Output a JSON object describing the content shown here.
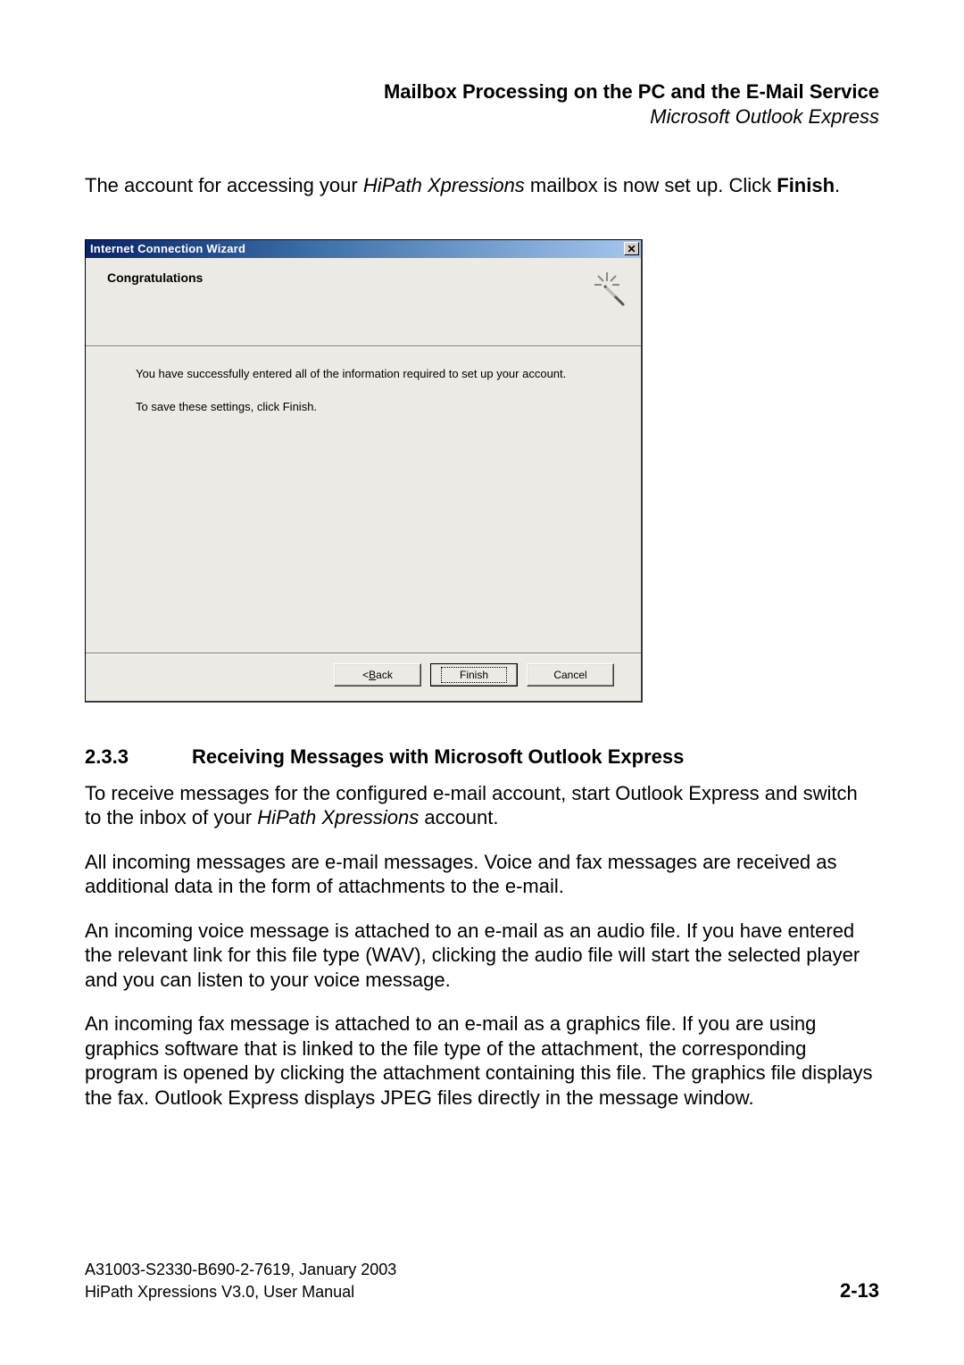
{
  "header": {
    "title": "Mailbox Processing on the PC and the E-Mail Service",
    "subtitle": "Microsoft Outlook Express"
  },
  "lead": {
    "pre": "The account for accessing your ",
    "italic": "HiPath Xpressions",
    "mid": " mailbox is now set up. Click ",
    "bold": "Finish",
    "post": "."
  },
  "dialog": {
    "title": "Internet Connection Wizard",
    "heading": "Congratulations",
    "body_line1": "You have successfully entered all of the information required to set up your account.",
    "body_line2": "To save these settings, click Finish.",
    "buttons": {
      "back_pre": "< ",
      "back_u": "B",
      "back_post": "ack",
      "finish": "Finish",
      "cancel": "Cancel"
    }
  },
  "section": {
    "number": "2.3.3",
    "title": "Receiving Messages with Microsoft Outlook Express",
    "p1_pre": "To receive messages for the configured e-mail account, start Outlook Express and switch to the inbox of your ",
    "p1_italic": "HiPath Xpressions",
    "p1_post": " account.",
    "p2": "All incoming messages are e-mail messages. Voice and fax messages are received as additional data in the form of attachments to the e-mail.",
    "p3": "An incoming voice message is attached to an e-mail as an audio file. If you have entered the relevant link for this file type (WAV), clicking the audio file will start the selected player and you can listen to your voice message.",
    "p4": "An incoming fax message is attached to an e-mail as a graphics file. If you are using graphics software that is linked to the file type of the attachment, the corresponding program is opened by clicking the attachment containing this file. The graphics file displays the fax. Outlook Express displays JPEG files directly in the message window."
  },
  "footer": {
    "line1": "A31003-S2330-B690-2-7619, January 2003",
    "line2": "HiPath Xpressions V3.0, User Manual",
    "page": "2-13"
  }
}
